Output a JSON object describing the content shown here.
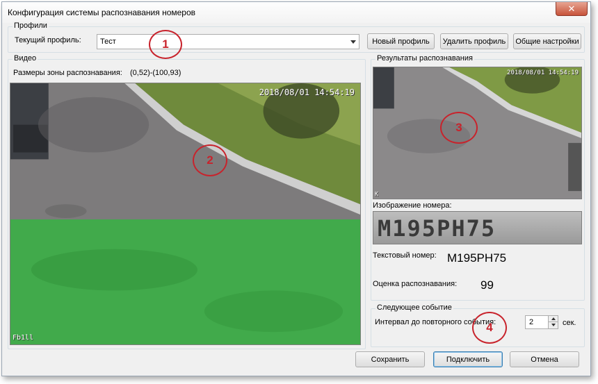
{
  "window": {
    "title": "Конфигурация системы распознавания номеров",
    "close_label": "✕"
  },
  "profiles": {
    "group_title": "Профили",
    "current_label": "Текущий профиль:",
    "current_value": "Тест",
    "new_button": "Новый профиль",
    "delete_button": "Удалить профиль",
    "settings_button": "Общие настройки"
  },
  "video": {
    "group_title": "Видео",
    "zone_label": "Размеры зоны распознавания:",
    "zone_value": "(0,52)-(100,93)",
    "timestamp": "2018/08/01 14:54:19",
    "corner_text": "Fb1ll"
  },
  "results": {
    "group_title": "Результаты распознавания",
    "timestamp": "2018/08/01 14:54:19",
    "corner_text": "K",
    "plate_image_label": "Изображение номера:",
    "plate_image_text": "M195PH75",
    "text_number_label": "Текстовый номер:",
    "text_number_value": "M195PH75",
    "score_label": "Оценка распознавания:",
    "score_value": "99"
  },
  "next_event": {
    "group_title": "Следующее событие",
    "interval_label": "Интервал до повторного события:",
    "interval_value": "2",
    "unit": "сек."
  },
  "annotations": [
    "1",
    "2",
    "3",
    "4"
  ],
  "footer": {
    "save_button": "Сохранить",
    "connect_button": "Подключить",
    "cancel_button": "Отмена"
  },
  "colors": {
    "annotation": "#c8232c",
    "zone_overlay": "#34b441",
    "close_button": "#c7533a"
  }
}
